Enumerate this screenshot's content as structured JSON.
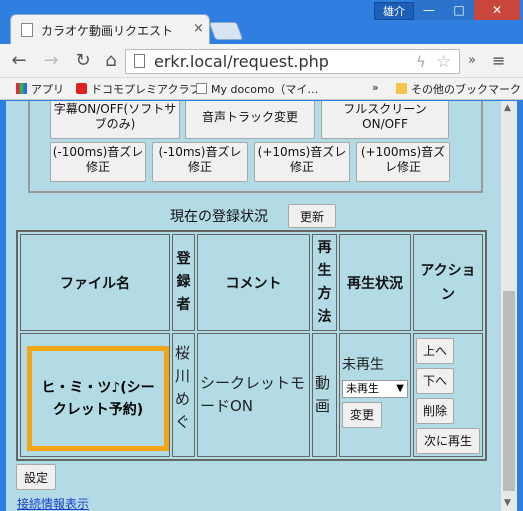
{
  "window": {
    "user_badge": "雄介",
    "minimize": "—",
    "maximize": "□",
    "close": "✕"
  },
  "tab": {
    "title": "カラオケ動画リクエスト",
    "close": "×"
  },
  "toolbar": {
    "back": "←",
    "forward": "→",
    "reload": "↻",
    "home": "⌂",
    "url": "erkr.local/request.php",
    "bolt": "ϟ",
    "star": "☆",
    "extensions": "»",
    "menu": "≡"
  },
  "bookmarks": {
    "items": [
      {
        "label": "アプリ",
        "icon": "apps-grid-icon"
      },
      {
        "label": "ドコモプレミアクラブ",
        "icon": "docomo-icon"
      },
      {
        "label": "My docomo（マイ…",
        "icon": "page-icon"
      }
    ],
    "more": "»",
    "other": "その他のブックマーク"
  },
  "controls": {
    "subtitle": "字幕ON/OFF(ソフトサブのみ)",
    "audio": "音声トラック変更",
    "fullscreen": "フルスクリーンON/OFF",
    "m100": "(-100ms)音ズレ修正",
    "m10": "(-10ms)音ズレ修正",
    "p10": "(+10ms)音ズレ修正",
    "p100": "(+100ms)音ズレ修正"
  },
  "status": {
    "label": "現在の登録状況",
    "refresh": "更新"
  },
  "table": {
    "headers": {
      "file": "ファイル名",
      "registrant": "登録者",
      "comment": "コメント",
      "method": "再生方法",
      "state": "再生状況",
      "action": "アクション"
    },
    "rows": [
      {
        "file": "ヒ・ミ・ツ♪(シークレット予約)",
        "registrant": "桜川めぐ",
        "comment": "シークレットモードON",
        "method": "動画",
        "state": "未再生",
        "state_select": "未再生",
        "change": "変更",
        "up": "上へ",
        "down": "下へ",
        "delete": "削除",
        "play_next": "次に再生"
      }
    ]
  },
  "footer": {
    "settings": "設定",
    "link": "接続情報表示"
  }
}
